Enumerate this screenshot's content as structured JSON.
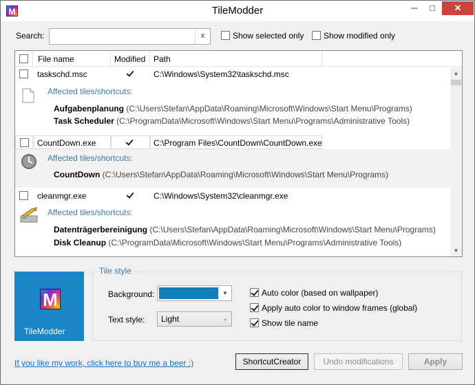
{
  "window": {
    "title": "TileModder",
    "icon": "tilemodder-app-icon",
    "minimize": "─",
    "maximize": "□",
    "close": "✕"
  },
  "search": {
    "label": "Search:",
    "value": "",
    "placeholder": "",
    "clear": "x"
  },
  "filters": {
    "show_selected": {
      "label": "Show selected only",
      "checked": false
    },
    "show_modified": {
      "label": "Show modified only",
      "checked": false
    }
  },
  "list": {
    "columns": {
      "file_name": "File name",
      "modified": "Modified",
      "path": "Path"
    },
    "items": [
      {
        "file": "taskschd.msc",
        "checked": false,
        "modified": true,
        "path": "C:\\Windows\\System32\\taskschd.msc",
        "icon": "document-icon",
        "affected_title": "Affected tiles/shortcuts:",
        "shortcuts": [
          {
            "name": "Aufgabenplanung",
            "path": "(C:\\Users\\Stefan\\AppData\\Roaming\\Microsoft\\Windows\\Start Menu\\Programs)"
          },
          {
            "name": "Task Scheduler",
            "path": "(C:\\ProgramData\\Microsoft\\Windows\\Start Menu\\Programs\\Administrative Tools)"
          }
        ]
      },
      {
        "file": "CountDown.exe",
        "checked": false,
        "modified": true,
        "path": "C:\\Program Files\\CountDown\\CountDown.exe",
        "icon": "clock-icon",
        "affected_title": "Affected tiles/shortcuts:",
        "shortcuts": [
          {
            "name": "CountDown",
            "path": "(C:\\Users\\Stefan\\AppData\\Roaming\\Microsoft\\Windows\\Start Menu\\Programs)"
          }
        ]
      },
      {
        "file": "cleanmgr.exe",
        "checked": false,
        "modified": true,
        "path": "C:\\Windows\\System32\\cleanmgr.exe",
        "icon": "disk-cleanup-icon",
        "affected_title": "Affected tiles/shortcuts:",
        "shortcuts": [
          {
            "name": "Datenträgerbereinigung",
            "path": "(C:\\Users\\Stefan\\AppData\\Roaming\\Microsoft\\Windows\\Start Menu\\Programs)"
          },
          {
            "name": "Disk Cleanup",
            "path": "(C:\\ProgramData\\Microsoft\\Windows\\Start Menu\\Programs\\Administrative Tools)"
          }
        ]
      }
    ]
  },
  "tile": {
    "label": "TileModder",
    "icon_letter": "M"
  },
  "tile_style": {
    "title": "Tile style",
    "background_label": "Background:",
    "background_color": "#0f7fbc",
    "text_style_label": "Text style:",
    "text_style_value": "Light",
    "auto_color": {
      "label": "Auto color (based on wallpaper)",
      "checked": true
    },
    "apply_frames": {
      "label": "Apply auto color to window frames (global)",
      "checked": true
    },
    "show_name": {
      "label": "Show tile name",
      "checked": true
    }
  },
  "footer": {
    "link": "If you like my work, click here to buy me a beer :)",
    "shortcut_creator": "ShortcutCreator",
    "undo": "Undo modifications",
    "apply": "Apply"
  }
}
